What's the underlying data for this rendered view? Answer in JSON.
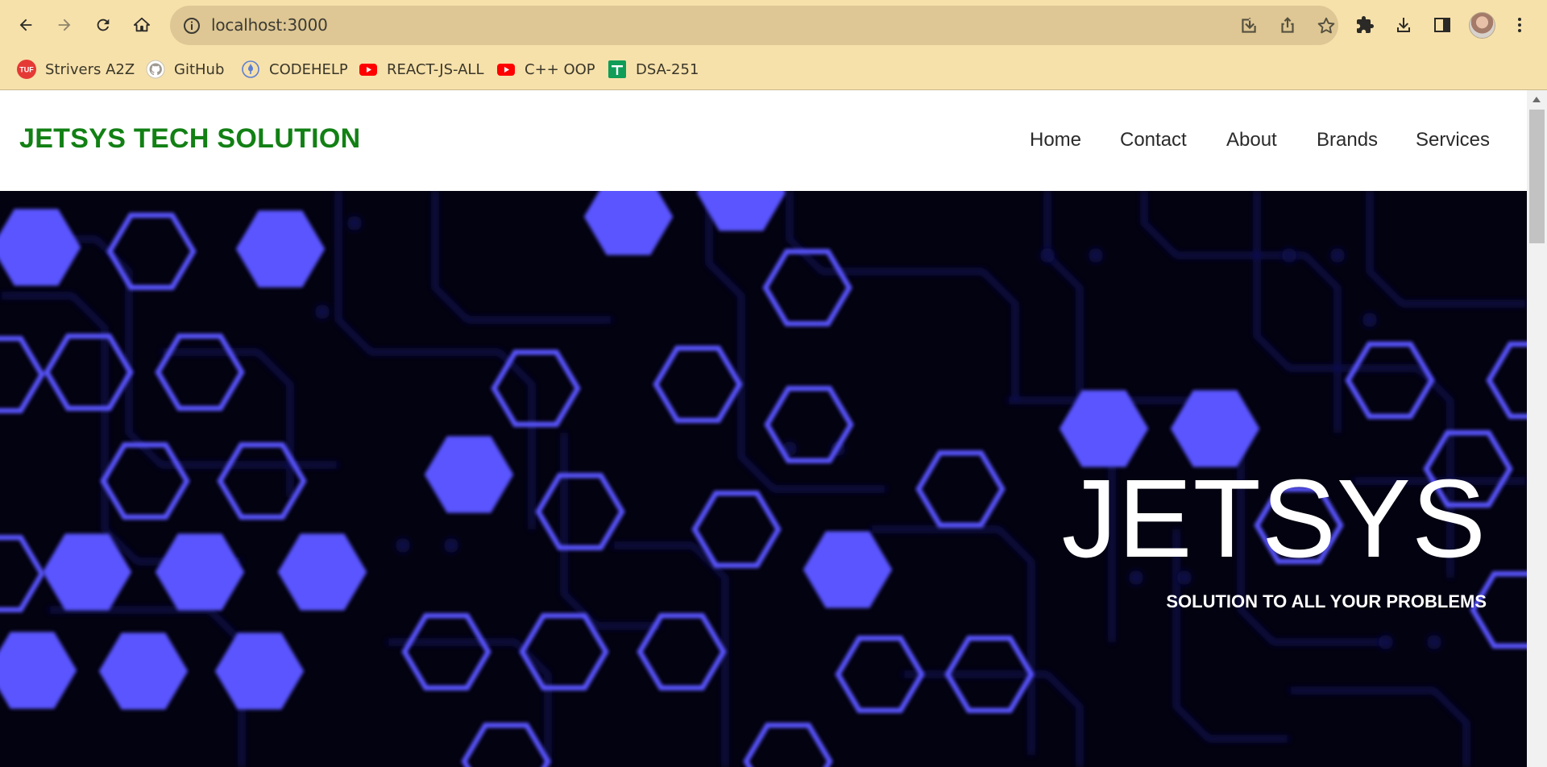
{
  "browser": {
    "url": "localhost:3000",
    "bookmarks": [
      {
        "label": "Strivers A2Z",
        "icon": "tuf-icon"
      },
      {
        "label": "GitHub",
        "icon": "github-icon"
      },
      {
        "label": "CODEHELP",
        "icon": "codehelp-icon"
      },
      {
        "label": "REACT-JS-ALL",
        "icon": "youtube-icon"
      },
      {
        "label": "C++ OOP",
        "icon": "youtube-icon"
      },
      {
        "label": "DSA-251",
        "icon": "sheets-icon"
      }
    ],
    "tuf_badge": "TUF"
  },
  "site": {
    "brand": "JETSYS TECH SOLUTION",
    "nav": [
      "Home",
      "Contact",
      "About",
      "Brands",
      "Services"
    ],
    "hero": {
      "title": "JETSYS",
      "subtitle": "SOLUTION TO ALL YOUR PROBLEMS"
    }
  },
  "colors": {
    "chrome_bg": "#f7e1ab",
    "omnibox_bg": "#dec794",
    "brand_green": "#128014",
    "hex_fill": "#5a55ff",
    "hero_bg": "#030210"
  }
}
